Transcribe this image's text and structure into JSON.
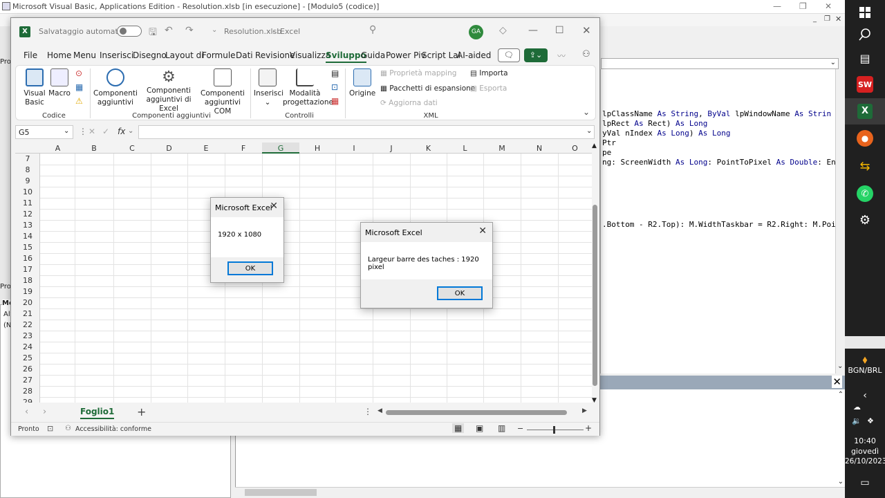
{
  "vbe": {
    "title": "Microsoft Visual Basic, Applications Edition - Resolution.xlsb [in esecuzione] - [Modulo5 (codice)]",
    "code_lines": [
      {
        "pre": "lpClassName ",
        "kw1": "As String",
        "mid": ", ",
        "kw2": "ByVal",
        "post": " lpWindowName ",
        "kw3": "As Strin"
      },
      {
        "pre": "lpRect ",
        "kw1": "As",
        "mid": " Rect) ",
        "kw2": "As Long",
        "post": "",
        "kw3": ""
      },
      {
        "pre": "yVal nIndex ",
        "kw1": "As Long",
        "mid": ") ",
        "kw2": "As Long",
        "post": "",
        "kw3": ""
      },
      {
        "pre": "Ptr",
        "kw1": "",
        "mid": "",
        "kw2": "",
        "post": "",
        "kw3": ""
      },
      {
        "pre": "pe",
        "kw1": "",
        "mid": "",
        "kw2": "",
        "post": "",
        "kw3": ""
      },
      {
        "pre": "ng: ScreenWidth ",
        "kw1": "As Long",
        "mid": ": PointToPixel ",
        "kw2": "As Double",
        "post": ": En",
        "kw3": ""
      },
      {
        "pre": ".Bottom - R2.Top): M.WidthTaskbar = R2.Right: M.Poi",
        "kw1": "",
        "mid": "",
        "kw2": "",
        "post": "",
        "kw3": ""
      }
    ],
    "left_labels": [
      "Pro",
      "Pro",
      "Mo",
      "Alf",
      "(Na"
    ]
  },
  "taskbar": {
    "time": "10:40",
    "day": "giovedì",
    "date": "26/10/2023",
    "ticker": "BGN/BRL"
  },
  "excel": {
    "autosave_label": "Salvataggio automatico",
    "filename": "Resolution.xlsb",
    "app_name": "Excel",
    "avatar": "GA",
    "tabs": [
      "File",
      "Home",
      "Menu",
      "Inserisci",
      "Disegno",
      "Layout di",
      "Formule",
      "Dati",
      "Revisione",
      "Visualizza",
      "Sviluppo",
      "Guida",
      "Power Piv",
      "Script Lal",
      "AI-aided"
    ],
    "ribbon": {
      "visual_basic": "Visual Basic",
      "macro": "Macro",
      "group_codice": "Codice",
      "componenti_aggiuntivi": "Componenti aggiuntivi",
      "componenti_excel": "Componenti aggiuntivi di Excel",
      "componenti_com": "Componenti aggiuntivi COM",
      "group_componenti": "Componenti aggiuntivi",
      "inserisci": "Inserisci",
      "modalita": "Modalità progettazione",
      "group_controlli": "Controlli",
      "origine": "Origine",
      "proprieta_mapping": "Proprietà mapping",
      "pacchetti": "Pacchetti di espansione",
      "aggiorna_dati": "Aggiorna dati",
      "importa": "Importa",
      "esporta": "Esporta",
      "group_xml": "XML"
    },
    "name_box": "G5",
    "fx": "fx",
    "columns": [
      "A",
      "B",
      "C",
      "D",
      "E",
      "F",
      "G",
      "H",
      "I",
      "J",
      "K",
      "L",
      "M",
      "N",
      "O"
    ],
    "rows": [
      "7",
      "8",
      "9",
      "10",
      "11",
      "12",
      "13",
      "14",
      "15",
      "16",
      "17",
      "18",
      "19",
      "20",
      "21",
      "22",
      "23",
      "24",
      "25",
      "26",
      "27",
      "28",
      "29"
    ],
    "sheet_tab": "Foglio1",
    "status_ready": "Pronto",
    "accessibility": "Accessibilità: conforme"
  },
  "dialog1": {
    "title": "Microsoft Excel",
    "message": "1920 x 1080",
    "ok": "OK"
  },
  "dialog2": {
    "title": "Microsoft Excel",
    "message": "Largeur barre des taches : 1920 pixel",
    "ok": "OK"
  },
  "colors": {
    "excel_green": "#1e6b38",
    "taskbar": "#202020",
    "accent_blue": "#0078d7"
  }
}
